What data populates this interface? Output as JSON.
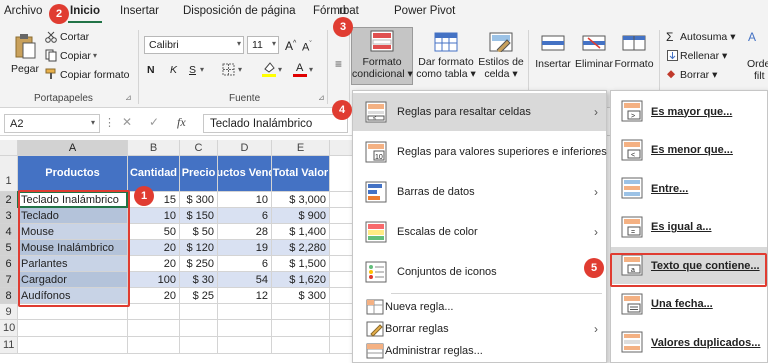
{
  "tabs": [
    "Archivo",
    "Inicio",
    "Insertar",
    "Disposición de página",
    "Fórmu",
    "rbat",
    "Power Pivot"
  ],
  "ribbon": {
    "clipboard": {
      "paste": "Pegar",
      "cut": "Cortar",
      "copy": "Copiar",
      "copy_format": "Copiar formato",
      "group": "Portapapeles"
    },
    "font": {
      "name": "Calibri",
      "size": "11",
      "bold": "N",
      "italic": "K",
      "underline": "S",
      "group": "Fuente"
    },
    "styles": {
      "cond_format_line1": "Formato",
      "cond_format_line2": "condicional",
      "table_format_line1": "Dar formato",
      "table_format_line2": "como tabla",
      "cell_styles_line1": "Estilos de",
      "cell_styles_line2": "celda"
    },
    "cells": {
      "insert": "Insertar",
      "delete": "Eliminar",
      "format": "Formato"
    },
    "editing": {
      "autosum": "Autosuma",
      "fill": "Rellenar",
      "clear": "Borrar",
      "sort_fragment_1": "A",
      "sort_fragment_2": "Orde",
      "sort_fragment_3": "filt"
    }
  },
  "formula_bar": {
    "cell_ref": "A2",
    "fx": "fx",
    "value": "Teclado Inalámbrico"
  },
  "columns": [
    "A",
    "B",
    "C",
    "D",
    "E"
  ],
  "rows": [
    "1",
    "2",
    "3",
    "4",
    "5",
    "6",
    "7",
    "8",
    "9",
    "10",
    "11"
  ],
  "table": {
    "headers": [
      "Productos",
      "Cantidad",
      "Precio",
      "Productos Vendidos",
      "Total Valor"
    ],
    "rows": [
      [
        "Teclado Inalámbrico",
        "15",
        "$ 300",
        "10",
        "$ 3,000"
      ],
      [
        "Teclado",
        "10",
        "$ 150",
        "6",
        "$ 900"
      ],
      [
        "Mouse",
        "50",
        "$ 50",
        "28",
        "$ 1,400"
      ],
      [
        "Mouse Inalámbrico",
        "20",
        "$ 120",
        "19",
        "$ 2,280"
      ],
      [
        "Parlantes",
        "20",
        "$ 250",
        "6",
        "$ 1,500"
      ],
      [
        "Cargador",
        "100",
        "$ 30",
        "54",
        "$ 1,620"
      ],
      [
        "Audífonos",
        "20",
        "$ 25",
        "12",
        "$ 300"
      ]
    ]
  },
  "cond_menu": {
    "items": [
      "Reglas para resaltar celdas",
      "Reglas para valores superiores e inferiores",
      "Barras de datos",
      "Escalas de color",
      "Conjuntos de iconos"
    ],
    "footer": [
      "Nueva regla...",
      "Borrar reglas",
      "Administrar reglas..."
    ]
  },
  "sub_menu": {
    "items": [
      "Es mayor que...",
      "Es menor que...",
      "Entre...",
      "Es igual a...",
      "Texto que contiene...",
      "Una fecha...",
      "Valores duplicados..."
    ]
  },
  "badges": [
    "1",
    "2",
    "3",
    "4",
    "5"
  ],
  "colors": {
    "accent": "#217346",
    "table_header": "#4472c4",
    "badge": "#e03c31"
  },
  "icons": [
    "paste-icon",
    "cut-icon",
    "copy-icon",
    "format-painter-icon",
    "conditional-format-icon",
    "table-format-icon",
    "cell-styles-icon",
    "insert-cells-icon",
    "delete-cells-icon",
    "format-cells-icon",
    "autosum-icon",
    "fill-icon",
    "clear-icon",
    "cancel-icon",
    "enter-icon",
    "fx-icon"
  ]
}
